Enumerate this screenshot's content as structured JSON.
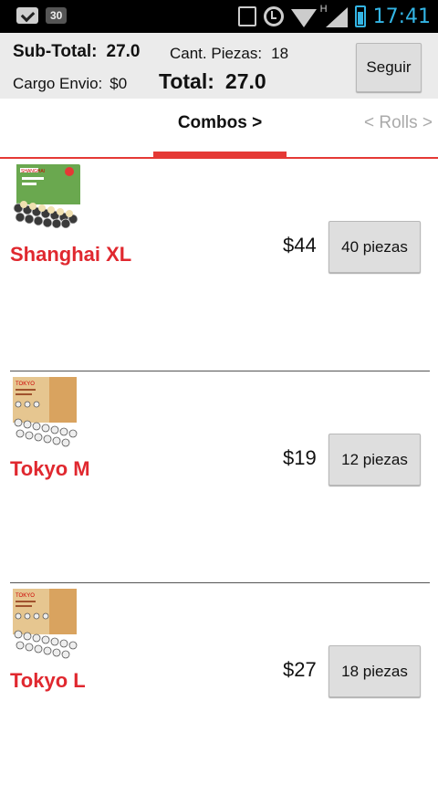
{
  "status_bar": {
    "notification_badge": "30",
    "time": "17:41",
    "network_type": "H"
  },
  "summary": {
    "subtotal_label": "Sub-Total:",
    "subtotal_value": "27.0",
    "cantidad_label": "Cant. Piezas:",
    "cantidad_value": "18",
    "cargo_label": "Cargo Envio:",
    "cargo_value": "$0",
    "total_label": "Total:",
    "total_value": "27.0",
    "seguir_label": "Seguir"
  },
  "tabs": {
    "current": "Combos >",
    "next": "< Rolls >"
  },
  "products": [
    {
      "name": "Shanghai XL",
      "price": "$44",
      "pieces_label": "40 piezas",
      "box_label": "SHANGHAI",
      "box_color": "#6aa84f"
    },
    {
      "name": "Tokyo M",
      "price": "$19",
      "pieces_label": "12 piezas",
      "box_label": "TOKYO",
      "box_color": "#d9a35f"
    },
    {
      "name": "Tokyo L",
      "price": "$27",
      "pieces_label": "18 piezas",
      "box_label": "TOKYO",
      "box_color": "#d9a35f"
    }
  ],
  "colors": {
    "accent": "#e53935",
    "product_name": "#e0282f",
    "status_time": "#33b5e5"
  }
}
